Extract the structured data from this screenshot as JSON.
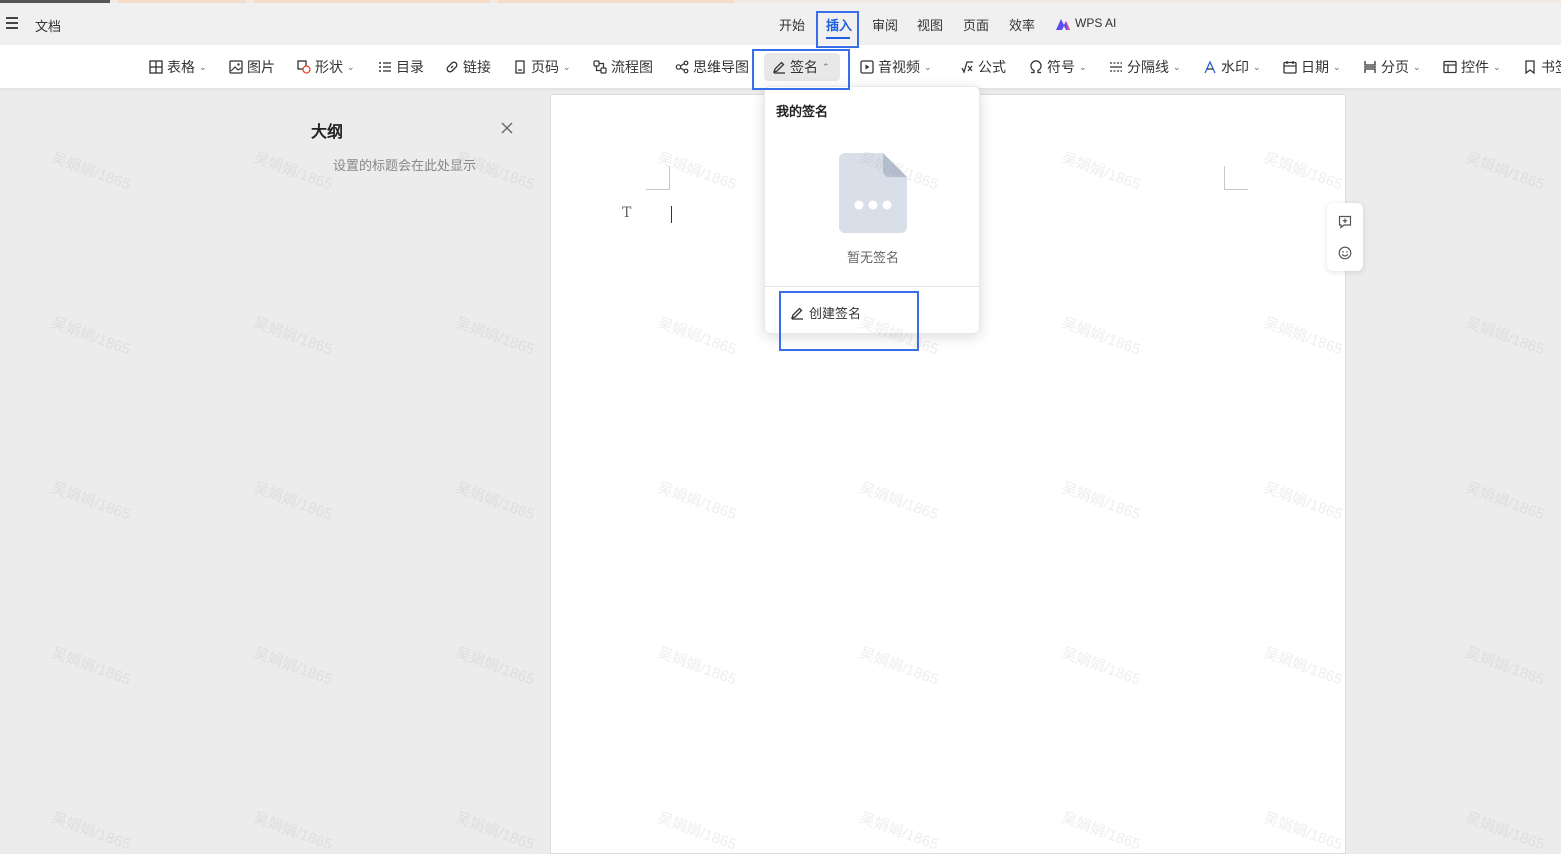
{
  "app": {
    "doc_label": "文档"
  },
  "menu": {
    "tabs": [
      {
        "label": "开始"
      },
      {
        "label": "插入"
      },
      {
        "label": "审阅"
      },
      {
        "label": "视图"
      },
      {
        "label": "页面"
      },
      {
        "label": "效率"
      },
      {
        "label": "WPS AI"
      }
    ],
    "active_tab": "插入",
    "accent_color": "#1f5fe0"
  },
  "toolbar": {
    "items": [
      {
        "label": "表格",
        "icon": "table-icon",
        "dropdown": true
      },
      {
        "label": "图片",
        "icon": "image-icon",
        "dropdown": false
      },
      {
        "label": "形状",
        "icon": "shape-icon",
        "dropdown": true
      },
      {
        "label": "目录",
        "icon": "list-icon",
        "dropdown": false
      },
      {
        "label": "链接",
        "icon": "link-icon",
        "dropdown": false
      },
      {
        "label": "页码",
        "icon": "page-number-icon",
        "dropdown": true
      },
      {
        "label": "流程图",
        "icon": "flowchart-icon",
        "dropdown": false
      },
      {
        "label": "思维导图",
        "icon": "mindmap-icon",
        "dropdown": false
      },
      {
        "label": "签名",
        "icon": "signature-icon",
        "dropdown": true,
        "expanded": true
      },
      {
        "label": "音视频",
        "icon": "media-icon",
        "dropdown": true
      },
      {
        "label": "公式",
        "icon": "formula-icon",
        "dropdown": false
      },
      {
        "label": "符号",
        "icon": "omega-icon",
        "dropdown": true
      },
      {
        "label": "分隔线",
        "icon": "divider-icon",
        "dropdown": true
      },
      {
        "label": "水印",
        "icon": "watermark-icon",
        "dropdown": true
      },
      {
        "label": "日期",
        "icon": "calendar-icon",
        "dropdown": true
      },
      {
        "label": "分页",
        "icon": "page-break-icon",
        "dropdown": true
      },
      {
        "label": "控件",
        "icon": "control-icon",
        "dropdown": true
      },
      {
        "label": "书签",
        "icon": "bookmark-icon",
        "dropdown": false
      }
    ]
  },
  "outline": {
    "title": "大纲",
    "hint": "设置的标题会在此处显示"
  },
  "editor": {
    "placeholder_glyph": "T"
  },
  "signature_menu": {
    "title": "我的签名",
    "empty_text": "暂无签名",
    "create_label": "创建签名"
  },
  "watermark": {
    "text": "吴娟娟/1865"
  }
}
